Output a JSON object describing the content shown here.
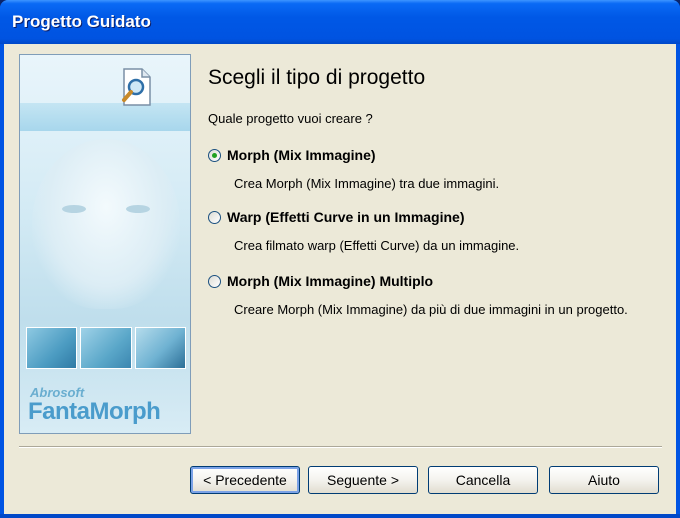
{
  "window": {
    "title": "Progetto Guidato"
  },
  "art": {
    "brand_top": "Abrosoft",
    "brand_main": "FantaMorph"
  },
  "content": {
    "heading": "Scegli il tipo di progetto",
    "question": "Quale progetto vuoi creare ?",
    "options": [
      {
        "label": "Morph (Mix Immagine)",
        "description": "Crea Morph (Mix Immagine) tra due immagini.",
        "checked": true
      },
      {
        "label": "Warp (Effetti Curve in un Immagine)",
        "description": "Crea filmato warp (Effetti Curve) da un immagine.",
        "checked": false
      },
      {
        "label": "Morph (Mix Immagine) Multiplo",
        "description": "Creare Morph (Mix Immagine) da più di due immagini in un progetto.",
        "checked": false
      }
    ]
  },
  "buttons": {
    "back": "< Precedente",
    "next": "Seguente >",
    "cancel": "Cancella",
    "help": "Aiuto"
  }
}
